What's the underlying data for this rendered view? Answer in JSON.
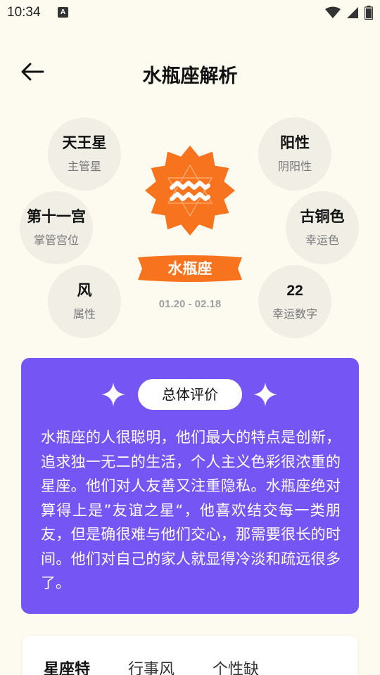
{
  "status": {
    "time": "10:34",
    "notif_letter": "A"
  },
  "header": {
    "title": "水瓶座解析"
  },
  "attributes": {
    "ruling_planet": {
      "value": "天王星",
      "label": "主管星"
    },
    "house": {
      "value": "第十一宫",
      "label": "掌管宫位"
    },
    "element": {
      "value": "风",
      "label": "属性"
    },
    "polarity": {
      "value": "阳性",
      "label": "阴阳性"
    },
    "lucky_color": {
      "value": "古铜色",
      "label": "幸运色"
    },
    "lucky_number": {
      "value": "22",
      "label": "幸运数字"
    }
  },
  "sign": {
    "name": "水瓶座",
    "dates": "01.20 - 02.18"
  },
  "evaluation": {
    "title": "总体评价",
    "text": "水瓶座的人很聪明，他们最大的特点是创新，追求独一无二的生活，个人主义色彩很浓重的星座。他们对人友善又注重隐私。水瓶座绝对算得上是”友谊之星“，他喜欢结交每一类朋友，但是确很难与他们交心，那需要很长的时间。他们对自己的家人就显得冷淡和疏远很多了。"
  },
  "tabs": [
    {
      "label": "星座特"
    },
    {
      "label": "行事风"
    },
    {
      "label": "个性缺"
    }
  ],
  "colors": {
    "accent_orange": "#f8731e",
    "card_purple": "#7555f3",
    "background": "#fdfbef",
    "circle_bg": "#f1eee6"
  }
}
